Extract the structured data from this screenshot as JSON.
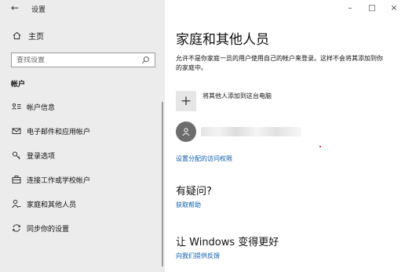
{
  "window": {
    "title": "设置",
    "back_symbol": "←",
    "controls": {
      "minimize": "–",
      "maximize": "□",
      "close": "×"
    }
  },
  "sidebar": {
    "home_label": "主页",
    "search": {
      "placeholder": "查找设置"
    },
    "section_header": "帐户",
    "items": [
      {
        "label": "帐户信息",
        "icon": "person-card-icon"
      },
      {
        "label": "电子邮件和应用帐户",
        "icon": "mail-icon"
      },
      {
        "label": "登录选项",
        "icon": "key-icon"
      },
      {
        "label": "连接工作或学校帐户",
        "icon": "briefcase-icon"
      },
      {
        "label": "家庭和其他人员",
        "icon": "person-add-icon"
      },
      {
        "label": "同步你的设置",
        "icon": "sync-icon"
      }
    ]
  },
  "main": {
    "title": "家庭和其他人员",
    "description": "允许不是你家庭一员的用户使用自己的帐户来登录。这样不会将其添加到你的家庭中。",
    "add_person_label": "将其他人添加到这台电脑",
    "assigned_access_link": "设置分配的访问权限",
    "questions_heading": "有疑问?",
    "get_help_link": "获取帮助",
    "improve_heading": "让 Windows 变得更好",
    "feedback_link": "向我们提供反馈"
  }
}
